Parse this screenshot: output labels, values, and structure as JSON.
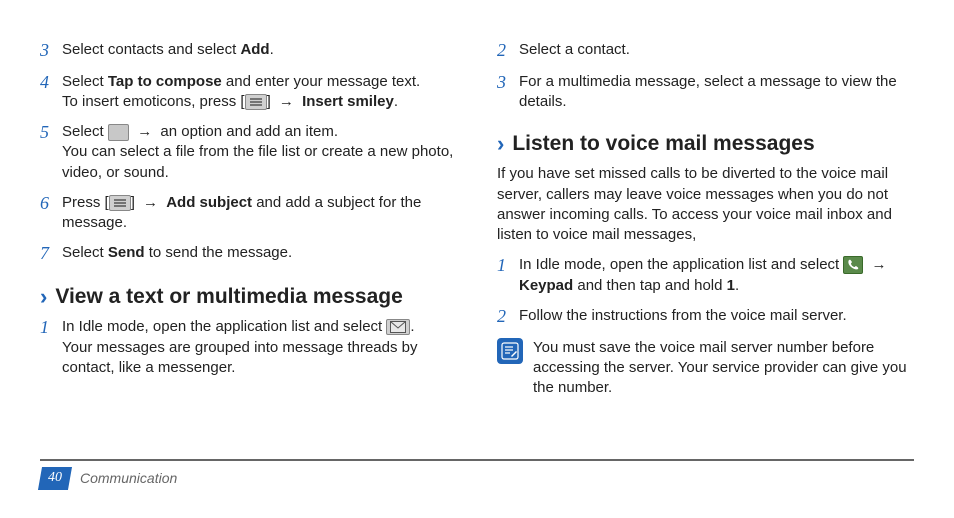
{
  "left": {
    "steps": [
      {
        "n": "3",
        "parts": [
          "Select contacts and select ",
          {
            "b": "Add"
          },
          "."
        ]
      },
      {
        "n": "4",
        "parts": [
          [
            "Select ",
            {
              "b": "Tap to compose"
            },
            " and enter your message text."
          ],
          [
            "To insert emoticons, press [",
            {
              "icon": "menu"
            },
            "] ",
            {
              "arrow": "→"
            },
            " ",
            {
              "b": "Insert smiley"
            },
            "."
          ]
        ]
      },
      {
        "n": "5",
        "parts": [
          [
            "Select ",
            {
              "icon": "attach"
            },
            " ",
            {
              "arrow": "→"
            },
            " an option and add an item."
          ],
          "You can select a file from the file list or create a new photo, video, or sound."
        ]
      },
      {
        "n": "6",
        "parts": [
          "Press [",
          {
            "icon": "menu"
          },
          "] ",
          {
            "arrow": "→"
          },
          " ",
          {
            "b": "Add subject"
          },
          " and add a subject for the message."
        ]
      },
      {
        "n": "7",
        "parts": [
          "Select ",
          {
            "b": "Send"
          },
          " to send the message."
        ]
      }
    ],
    "heading": "View a text or multimedia message",
    "steps2": [
      {
        "n": "1",
        "parts": [
          [
            "In Idle mode, open the application list and select ",
            {
              "icon": "env"
            },
            "."
          ],
          "Your messages are grouped into message threads by contact, like a messenger."
        ]
      }
    ]
  },
  "right": {
    "steps": [
      {
        "n": "2",
        "parts": [
          "Select a contact."
        ]
      },
      {
        "n": "3",
        "parts": [
          "For a multimedia message, select a message to view the details."
        ]
      }
    ],
    "heading": "Listen to voice mail messages",
    "intro": "If you have set missed calls to be diverted to the voice mail server, callers may leave voice messages when you do not answer incoming calls. To access your voice mail inbox and listen to voice mail messages,",
    "steps2": [
      {
        "n": "1",
        "parts": [
          [
            "In Idle mode, open the application list and select ",
            {
              "icon": "phone"
            },
            " ",
            {
              "arrow": "→"
            },
            " ",
            {
              "b": "Keypad"
            },
            " and then tap and hold ",
            {
              "b": "1"
            },
            "."
          ]
        ]
      },
      {
        "n": "2",
        "parts": [
          "Follow the instructions from the voice mail server."
        ]
      }
    ],
    "note": "You must save the voice mail server number before accessing the server. Your service provider can give you the number."
  },
  "footer": {
    "page": "40",
    "section": "Communication"
  }
}
